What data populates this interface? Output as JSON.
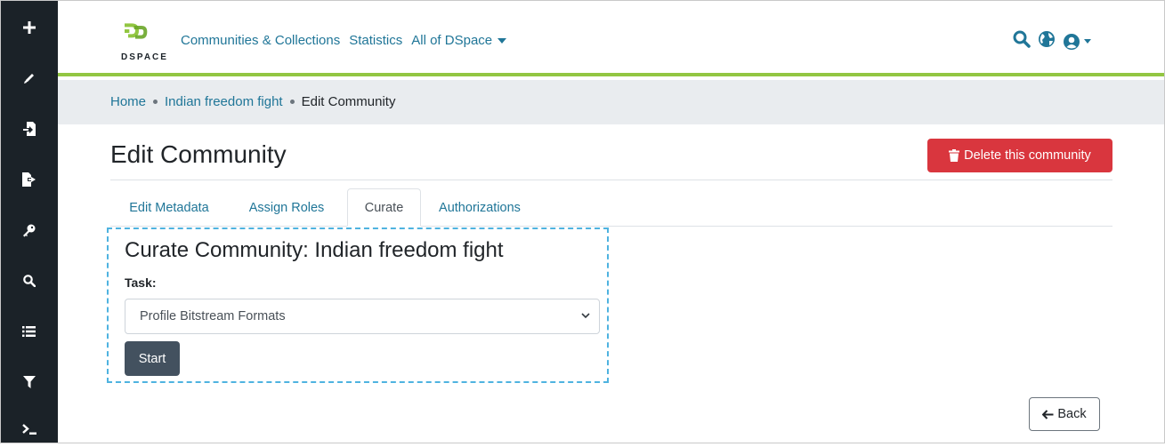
{
  "sidebar": {
    "icons": [
      "plus-icon",
      "pencil-icon",
      "import-icon",
      "export-icon",
      "key-icon",
      "search-icon",
      "list-icon",
      "filter-icon",
      "terminal-icon"
    ]
  },
  "header": {
    "logo_text": "DSPACE",
    "nav": {
      "communities": "Communities & Collections",
      "statistics": "Statistics",
      "all_of_dspace": "All of DSpace"
    },
    "icons": [
      "search-icon",
      "globe-icon",
      "user-icon"
    ]
  },
  "breadcrumb": {
    "home": "Home",
    "community": "Indian freedom fight",
    "current": "Edit Community"
  },
  "main": {
    "title": "Edit Community",
    "delete_label": "Delete this community",
    "tabs": [
      {
        "label": "Edit Metadata",
        "active": false
      },
      {
        "label": "Assign Roles",
        "active": false
      },
      {
        "label": "Curate",
        "active": true
      },
      {
        "label": "Authorizations",
        "active": false
      }
    ],
    "curate": {
      "title": "Curate Community: Indian freedom fight",
      "task_label": "Task:",
      "task_value": "Profile Bitstream Formats",
      "start_label": "Start"
    },
    "back_label": "Back"
  },
  "colors": {
    "sidebar_bg": "#1b2228",
    "brand_green": "#92c642",
    "link": "#207698",
    "danger": "#d9363e",
    "start_btn": "#43515f",
    "focus_outline": "#4fb3e0"
  }
}
